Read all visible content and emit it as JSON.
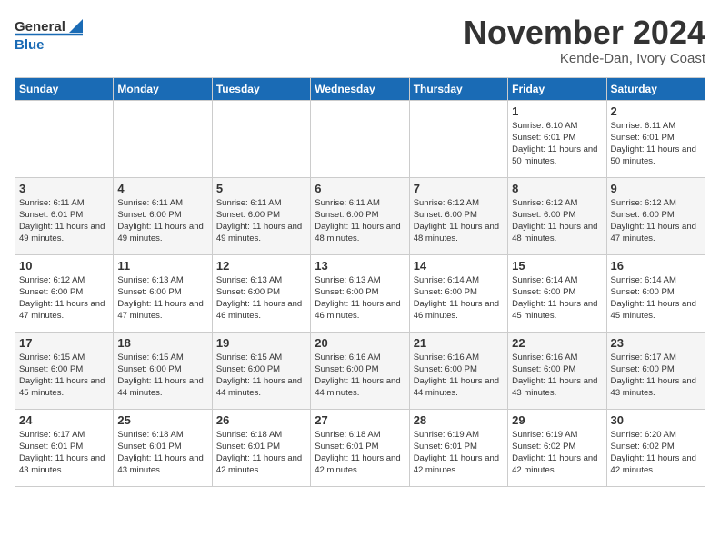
{
  "header": {
    "logo_general": "General",
    "logo_blue": "Blue",
    "month": "November 2024",
    "location": "Kende-Dan, Ivory Coast"
  },
  "weekdays": [
    "Sunday",
    "Monday",
    "Tuesday",
    "Wednesday",
    "Thursday",
    "Friday",
    "Saturday"
  ],
  "weeks": [
    [
      {
        "day": "",
        "info": ""
      },
      {
        "day": "",
        "info": ""
      },
      {
        "day": "",
        "info": ""
      },
      {
        "day": "",
        "info": ""
      },
      {
        "day": "",
        "info": ""
      },
      {
        "day": "1",
        "info": "Sunrise: 6:10 AM\nSunset: 6:01 PM\nDaylight: 11 hours\nand 50 minutes."
      },
      {
        "day": "2",
        "info": "Sunrise: 6:11 AM\nSunset: 6:01 PM\nDaylight: 11 hours\nand 50 minutes."
      }
    ],
    [
      {
        "day": "3",
        "info": "Sunrise: 6:11 AM\nSunset: 6:01 PM\nDaylight: 11 hours\nand 49 minutes."
      },
      {
        "day": "4",
        "info": "Sunrise: 6:11 AM\nSunset: 6:00 PM\nDaylight: 11 hours\nand 49 minutes."
      },
      {
        "day": "5",
        "info": "Sunrise: 6:11 AM\nSunset: 6:00 PM\nDaylight: 11 hours\nand 49 minutes."
      },
      {
        "day": "6",
        "info": "Sunrise: 6:11 AM\nSunset: 6:00 PM\nDaylight: 11 hours\nand 48 minutes."
      },
      {
        "day": "7",
        "info": "Sunrise: 6:12 AM\nSunset: 6:00 PM\nDaylight: 11 hours\nand 48 minutes."
      },
      {
        "day": "8",
        "info": "Sunrise: 6:12 AM\nSunset: 6:00 PM\nDaylight: 11 hours\nand 48 minutes."
      },
      {
        "day": "9",
        "info": "Sunrise: 6:12 AM\nSunset: 6:00 PM\nDaylight: 11 hours\nand 47 minutes."
      }
    ],
    [
      {
        "day": "10",
        "info": "Sunrise: 6:12 AM\nSunset: 6:00 PM\nDaylight: 11 hours\nand 47 minutes."
      },
      {
        "day": "11",
        "info": "Sunrise: 6:13 AM\nSunset: 6:00 PM\nDaylight: 11 hours\nand 47 minutes."
      },
      {
        "day": "12",
        "info": "Sunrise: 6:13 AM\nSunset: 6:00 PM\nDaylight: 11 hours\nand 46 minutes."
      },
      {
        "day": "13",
        "info": "Sunrise: 6:13 AM\nSunset: 6:00 PM\nDaylight: 11 hours\nand 46 minutes."
      },
      {
        "day": "14",
        "info": "Sunrise: 6:14 AM\nSunset: 6:00 PM\nDaylight: 11 hours\nand 46 minutes."
      },
      {
        "day": "15",
        "info": "Sunrise: 6:14 AM\nSunset: 6:00 PM\nDaylight: 11 hours\nand 45 minutes."
      },
      {
        "day": "16",
        "info": "Sunrise: 6:14 AM\nSunset: 6:00 PM\nDaylight: 11 hours\nand 45 minutes."
      }
    ],
    [
      {
        "day": "17",
        "info": "Sunrise: 6:15 AM\nSunset: 6:00 PM\nDaylight: 11 hours\nand 45 minutes."
      },
      {
        "day": "18",
        "info": "Sunrise: 6:15 AM\nSunset: 6:00 PM\nDaylight: 11 hours\nand 44 minutes."
      },
      {
        "day": "19",
        "info": "Sunrise: 6:15 AM\nSunset: 6:00 PM\nDaylight: 11 hours\nand 44 minutes."
      },
      {
        "day": "20",
        "info": "Sunrise: 6:16 AM\nSunset: 6:00 PM\nDaylight: 11 hours\nand 44 minutes."
      },
      {
        "day": "21",
        "info": "Sunrise: 6:16 AM\nSunset: 6:00 PM\nDaylight: 11 hours\nand 44 minutes."
      },
      {
        "day": "22",
        "info": "Sunrise: 6:16 AM\nSunset: 6:00 PM\nDaylight: 11 hours\nand 43 minutes."
      },
      {
        "day": "23",
        "info": "Sunrise: 6:17 AM\nSunset: 6:00 PM\nDaylight: 11 hours\nand 43 minutes."
      }
    ],
    [
      {
        "day": "24",
        "info": "Sunrise: 6:17 AM\nSunset: 6:01 PM\nDaylight: 11 hours\nand 43 minutes."
      },
      {
        "day": "25",
        "info": "Sunrise: 6:18 AM\nSunset: 6:01 PM\nDaylight: 11 hours\nand 43 minutes."
      },
      {
        "day": "26",
        "info": "Sunrise: 6:18 AM\nSunset: 6:01 PM\nDaylight: 11 hours\nand 42 minutes."
      },
      {
        "day": "27",
        "info": "Sunrise: 6:18 AM\nSunset: 6:01 PM\nDaylight: 11 hours\nand 42 minutes."
      },
      {
        "day": "28",
        "info": "Sunrise: 6:19 AM\nSunset: 6:01 PM\nDaylight: 11 hours\nand 42 minutes."
      },
      {
        "day": "29",
        "info": "Sunrise: 6:19 AM\nSunset: 6:02 PM\nDaylight: 11 hours\nand 42 minutes."
      },
      {
        "day": "30",
        "info": "Sunrise: 6:20 AM\nSunset: 6:02 PM\nDaylight: 11 hours\nand 42 minutes."
      }
    ]
  ]
}
